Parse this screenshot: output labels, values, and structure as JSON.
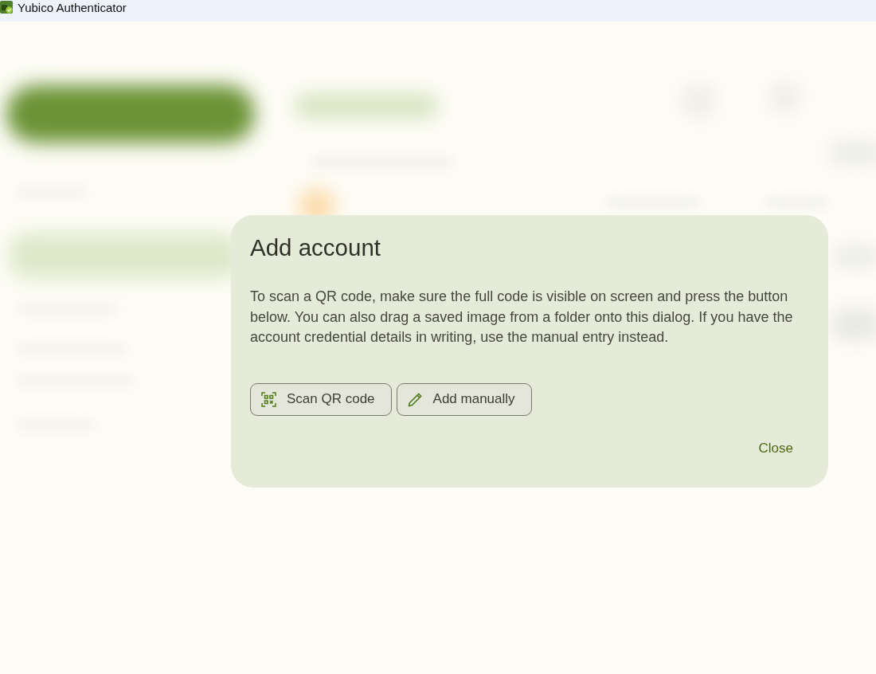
{
  "window": {
    "title": "Yubico Authenticator"
  },
  "dialog": {
    "title": "Add account",
    "message": "To scan a QR code, make sure the full code is visible on screen and press the button below. You can also drag a saved image from a folder onto this dialog. If you have the account credential details in writing, use the manual entry instead.",
    "actions": [
      {
        "label": "Scan QR code",
        "kind": "scan"
      },
      {
        "label": "Add manually",
        "kind": "manual"
      }
    ],
    "close_button": "Close"
  }
}
